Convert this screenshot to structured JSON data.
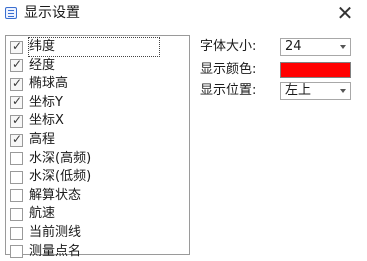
{
  "window": {
    "title": "显示设置",
    "close_glyph": "✕"
  },
  "items": [
    {
      "label": "纬度",
      "checked": true
    },
    {
      "label": "经度",
      "checked": true
    },
    {
      "label": "椭球高",
      "checked": true
    },
    {
      "label": "坐标Y",
      "checked": true
    },
    {
      "label": "坐标X",
      "checked": true
    },
    {
      "label": "高程",
      "checked": true
    },
    {
      "label": "水深(高频)",
      "checked": false
    },
    {
      "label": "水深(低频)",
      "checked": false
    },
    {
      "label": "解算状态",
      "checked": false
    },
    {
      "label": "航速",
      "checked": false
    },
    {
      "label": "当前测线",
      "checked": false
    },
    {
      "label": "测量点名",
      "checked": false
    }
  ],
  "settings": {
    "font_size_label": "字体大小:",
    "font_size_value": "24",
    "color_label": "显示颜色:",
    "color_value": "#ff0000",
    "position_label": "显示位置:",
    "position_value": "左上"
  }
}
